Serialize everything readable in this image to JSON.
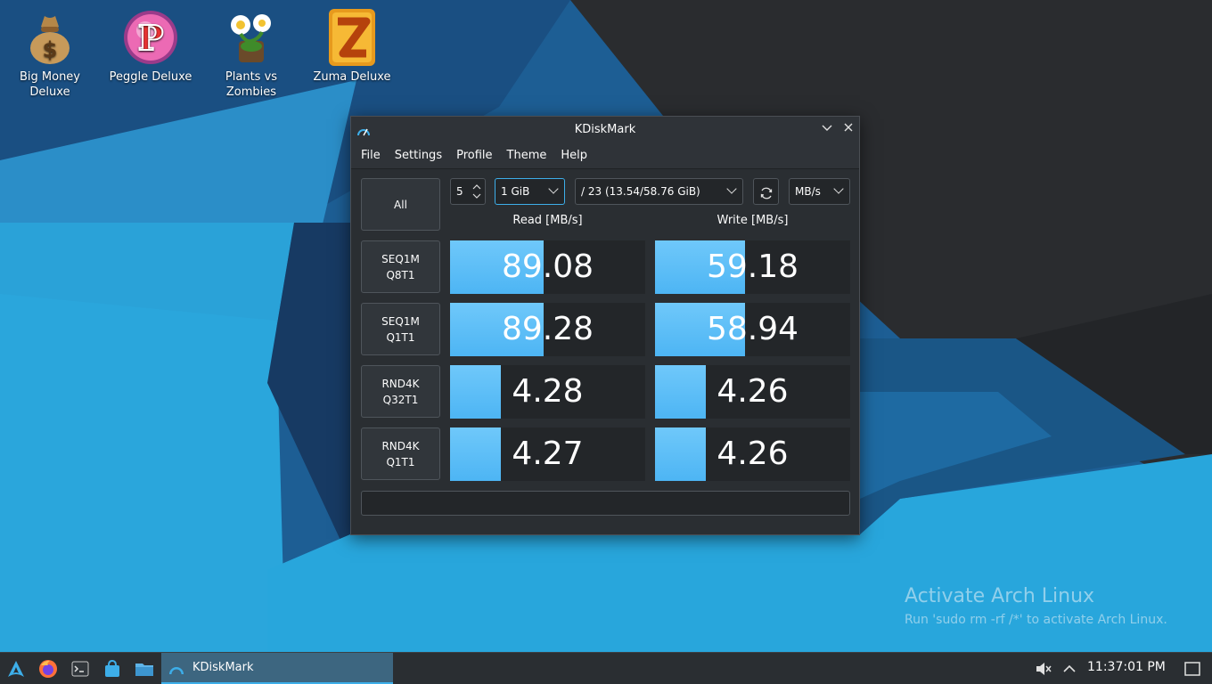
{
  "desktop": {
    "icons": [
      {
        "label": "Big Money\nDeluxe",
        "icon": "money-bag-icon"
      },
      {
        "label": "Peggle Deluxe",
        "icon": "peggle-icon"
      },
      {
        "label": "Plants vs\nZombies",
        "icon": "plants-vs-zombies-icon"
      },
      {
        "label": "Zuma Deluxe",
        "icon": "zuma-icon"
      }
    ],
    "watermark": {
      "title": "Activate Arch Linux",
      "subtitle": "Run 'sudo rm -rf /*' to activate Arch Linux."
    }
  },
  "window": {
    "title": "KDiskMark",
    "menu": [
      "File",
      "Settings",
      "Profile",
      "Theme",
      "Help"
    ],
    "controls": {
      "all_button": "All",
      "runs": "5",
      "size": "1 GiB",
      "target": "/ 23 (13.54/58.76 GiB)",
      "unit": "MB/s"
    },
    "headers": {
      "read": "Read [MB/s]",
      "write": "Write [MB/s]"
    },
    "tests": [
      {
        "label": "SEQ1M\nQ8T1",
        "read": "89.08",
        "write": "59.18",
        "read_level": 0.48,
        "write_level": 0.46
      },
      {
        "label": "SEQ1M\nQ1T1",
        "read": "89.28",
        "write": "58.94",
        "read_level": 0.48,
        "write_level": 0.46
      },
      {
        "label": "RND4K\nQ32T1",
        "read": "4.28",
        "write": "4.26",
        "read_level": 0.26,
        "write_level": 0.26
      },
      {
        "label": "RND4K\nQ1T1",
        "read": "4.27",
        "write": "4.26",
        "read_level": 0.26,
        "write_level": 0.26
      }
    ],
    "accent": "#4db5f4"
  },
  "taskbar": {
    "launchers": [
      "application-launcher-icon",
      "firefox-icon",
      "terminal-icon",
      "store-icon",
      "file-manager-icon"
    ],
    "task_label": "KDiskMark",
    "clock": "11:37:01 PM"
  }
}
